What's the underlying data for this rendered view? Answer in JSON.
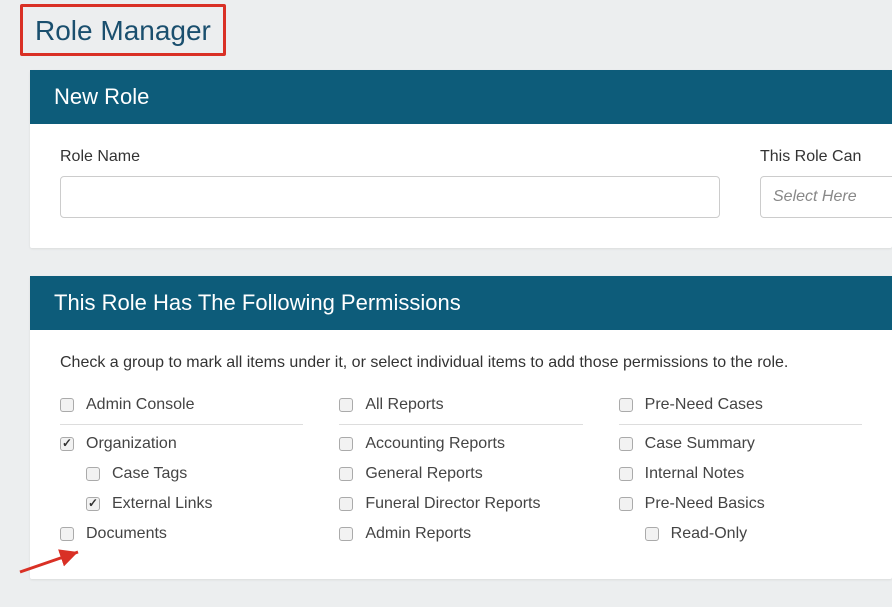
{
  "page": {
    "title": "Role Manager"
  },
  "newRole": {
    "header": "New Role",
    "nameLabel": "Role Name",
    "nameValue": "",
    "canLabel": "This Role Can",
    "canPlaceholder": "Select Here"
  },
  "permissions": {
    "header": "This Role Has The Following Permissions",
    "intro": "Check a group to mark all items under it, or select individual items to add those permissions to the role.",
    "col1": [
      {
        "label": "Admin Console",
        "checked": false,
        "groupHead": true,
        "indent": 0
      },
      {
        "label": "Organization",
        "checked": true,
        "groupHead": false,
        "indent": 0
      },
      {
        "label": "Case Tags",
        "checked": false,
        "groupHead": false,
        "indent": 1
      },
      {
        "label": "External Links",
        "checked": true,
        "groupHead": false,
        "indent": 1
      },
      {
        "label": "Documents",
        "checked": false,
        "groupHead": false,
        "indent": 0
      }
    ],
    "col2": [
      {
        "label": "All Reports",
        "checked": false,
        "groupHead": true,
        "indent": 0
      },
      {
        "label": "Accounting Reports",
        "checked": false,
        "groupHead": false,
        "indent": 0
      },
      {
        "label": "General Reports",
        "checked": false,
        "groupHead": false,
        "indent": 0
      },
      {
        "label": "Funeral Director Reports",
        "checked": false,
        "groupHead": false,
        "indent": 0
      },
      {
        "label": "Admin Reports",
        "checked": false,
        "groupHead": false,
        "indent": 0
      }
    ],
    "col3": [
      {
        "label": "Pre-Need Cases",
        "checked": false,
        "groupHead": true,
        "indent": 0
      },
      {
        "label": "Case Summary",
        "checked": false,
        "groupHead": false,
        "indent": 0
      },
      {
        "label": "Internal Notes",
        "checked": false,
        "groupHead": false,
        "indent": 0
      },
      {
        "label": "Pre-Need Basics",
        "checked": false,
        "groupHead": false,
        "indent": 0
      },
      {
        "label": "Read-Only",
        "checked": false,
        "groupHead": false,
        "indent": 1
      }
    ]
  }
}
